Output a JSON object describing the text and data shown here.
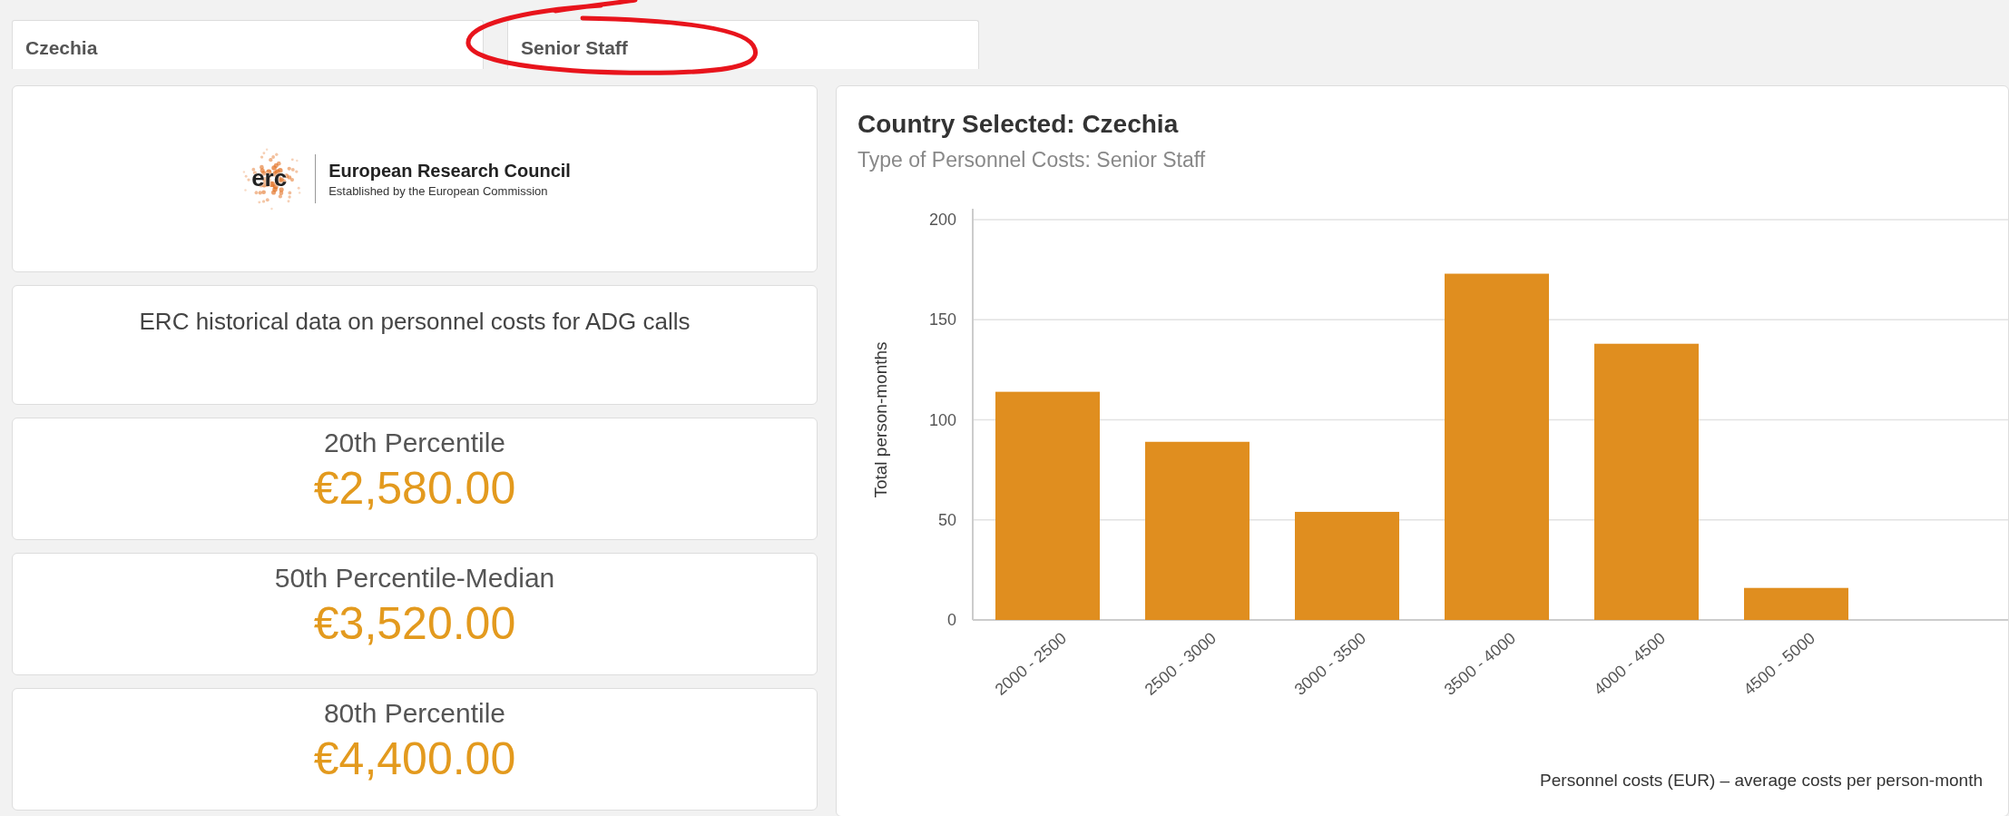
{
  "filters": [
    {
      "label": "Czechia"
    },
    {
      "label": "Senior Staff"
    }
  ],
  "logo": {
    "mark": "erc",
    "name": "European Research Council",
    "tagline": "Established by the European Commission"
  },
  "title_card": {
    "text": "ERC historical data on personnel costs for ADG calls"
  },
  "stats": [
    {
      "label": "20th Percentile",
      "value": "€2,580.00"
    },
    {
      "label": "50th Percentile-Median",
      "value": "€3,520.00"
    },
    {
      "label": "80th Percentile",
      "value": "€4,400.00"
    }
  ],
  "chart_panel": {
    "title": "Country Selected: Czechia",
    "subtitle": "Type of Personnel Costs: Senior Staff",
    "chart_data": {
      "type": "bar",
      "xlabel": "Personnel costs (EUR) – average costs per person-month",
      "ylabel": "Total person-months",
      "categories": [
        "2000 - 2500",
        "2500 - 3000",
        "3000 - 3500",
        "3500 - 4000",
        "4000 - 4500",
        "4500 - 5000"
      ],
      "grid": true,
      "series": [
        {
          "color": "#e08e1f",
          "values": [
            114,
            89,
            54,
            173,
            138,
            16
          ]
        }
      ],
      "ylim": [
        0,
        200
      ],
      "yticks": [
        0,
        50,
        100,
        150,
        200
      ]
    }
  }
}
